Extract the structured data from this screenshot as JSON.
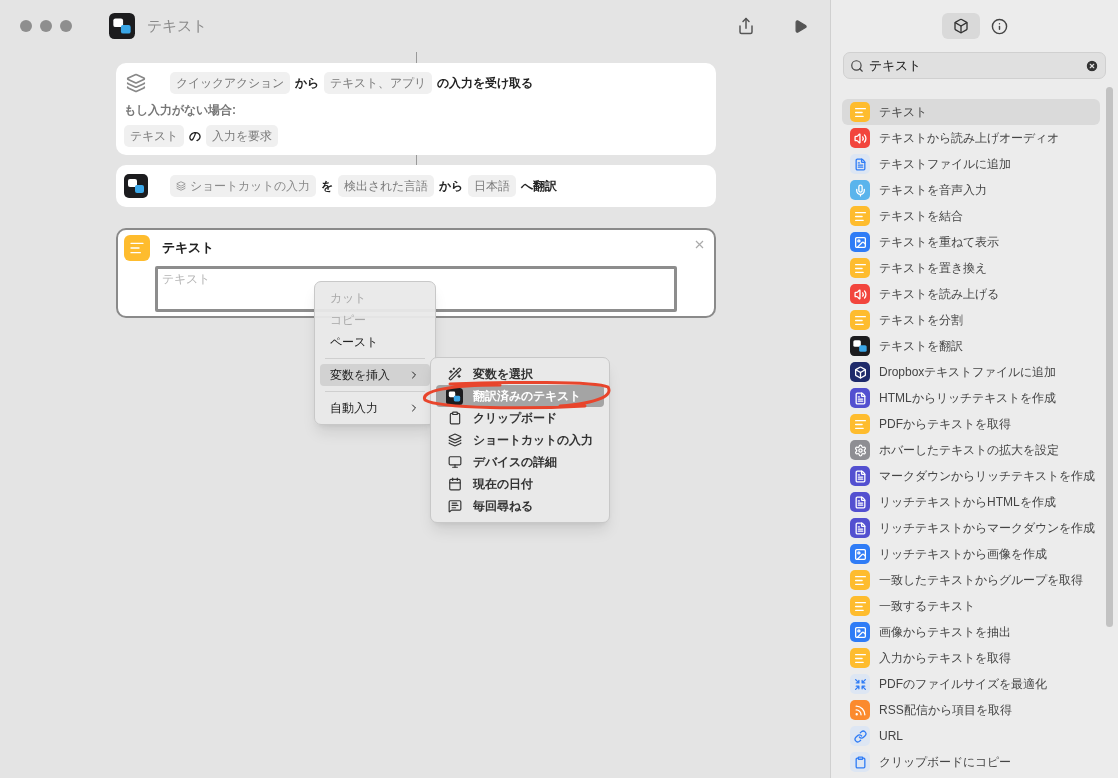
{
  "window": {
    "title": "テキスト"
  },
  "actions": [
    {
      "kind": "receive",
      "lines": [
        [
          {
            "kind": "chip",
            "text": "クイックアクション"
          },
          {
            "kind": "word",
            "text": "から"
          },
          {
            "kind": "chip",
            "text": "テキスト、アプリ"
          },
          {
            "kind": "word",
            "text": "の入力を受け取る"
          }
        ],
        [
          {
            "kind": "label",
            "text": "もし入力がない場合:"
          }
        ],
        [
          {
            "kind": "chip",
            "text": "テキスト"
          },
          {
            "kind": "word",
            "text": "の"
          },
          {
            "kind": "chip",
            "text": "入力を要求"
          }
        ]
      ]
    },
    {
      "kind": "translate",
      "lines": [
        [
          {
            "kind": "variable",
            "text": "ショートカットの入力"
          },
          {
            "kind": "word",
            "text": "を"
          },
          {
            "kind": "chip",
            "text": "検出された言語"
          },
          {
            "kind": "word",
            "text": "から"
          },
          {
            "kind": "chip",
            "text": "日本語"
          },
          {
            "kind": "word",
            "text": "へ翻訳"
          }
        ]
      ]
    },
    {
      "kind": "text",
      "title": "テキスト",
      "placeholder": "テキスト",
      "selected": true
    }
  ],
  "context_menu": {
    "items": [
      {
        "kind": "action",
        "label": "カット",
        "disabled": true,
        "selected": false
      },
      {
        "kind": "action",
        "label": "コピー",
        "disabled": true,
        "selected": false
      },
      {
        "kind": "action",
        "label": "ペースト",
        "disabled": false,
        "selected": false
      },
      {
        "kind": "submenu",
        "label": "変数を挿入",
        "disabled": false,
        "selected": true
      },
      {
        "kind": "submenu",
        "label": "自動入力",
        "disabled": false,
        "selected": false
      }
    ],
    "submenu": [
      {
        "kind": "wand",
        "label": "変数を選択",
        "selected": false
      },
      {
        "kind": "translate",
        "label": "翻訳済みのテキスト",
        "selected": true
      },
      {
        "kind": "clipboard",
        "label": "クリップボード",
        "selected": false
      },
      {
        "kind": "layers",
        "label": "ショートカットの入力",
        "selected": false
      },
      {
        "kind": "monitor",
        "label": "デバイスの詳細",
        "selected": false
      },
      {
        "kind": "calendar",
        "label": "現在の日付",
        "selected": false
      },
      {
        "kind": "speech",
        "label": "毎回尋ねる",
        "selected": false
      }
    ]
  },
  "sidebar": {
    "search": {
      "value": "テキスト"
    },
    "items": [
      {
        "kind": "text",
        "label": "テキスト",
        "color": "#febc2e",
        "selected": true
      },
      {
        "kind": "speaker",
        "label": "テキストから読み上げオーディオ",
        "color": "#f2453d",
        "selected": false
      },
      {
        "kind": "file",
        "label": "テキストファイルに追加",
        "color": "#dde6f3",
        "selected": false
      },
      {
        "kind": "mic",
        "label": "テキストを音声入力",
        "color": "#5ab4ec",
        "selected": false
      },
      {
        "kind": "text",
        "label": "テキストを結合",
        "color": "#febc2e",
        "selected": false
      },
      {
        "kind": "overlay",
        "label": "テキストを重ねて表示",
        "color": "#2f7cf6",
        "selected": false
      },
      {
        "kind": "text",
        "label": "テキストを置き換え",
        "color": "#febc2e",
        "selected": false
      },
      {
        "kind": "speaker",
        "label": "テキストを読み上げる",
        "color": "#f2453d",
        "selected": false
      },
      {
        "kind": "text",
        "label": "テキストを分割",
        "color": "#febc2e",
        "selected": false
      },
      {
        "kind": "translate",
        "label": "テキストを翻訳",
        "color": "#1c1c1e",
        "selected": false
      },
      {
        "kind": "dropbox",
        "label": "Dropboxテキストファイルに追加",
        "color": "#1e2a6b",
        "selected": false
      },
      {
        "kind": "rich",
        "label": "HTMLからリッチテキストを作成",
        "color": "#5350d0",
        "selected": false
      },
      {
        "kind": "text",
        "label": "PDFからテキストを取得",
        "color": "#febc2e",
        "selected": false
      },
      {
        "kind": "gear",
        "label": "ホバーしたテキストの拡大を設定",
        "color": "#8e8e93",
        "selected": false
      },
      {
        "kind": "rich",
        "label": "マークダウンからリッチテキストを作成",
        "color": "#5350d0",
        "selected": false
      },
      {
        "kind": "rich",
        "label": "リッチテキストからHTMLを作成",
        "color": "#5350d0",
        "selected": false
      },
      {
        "kind": "rich",
        "label": "リッチテキストからマークダウンを作成",
        "color": "#5350d0",
        "selected": false
      },
      {
        "kind": "image",
        "label": "リッチテキストから画像を作成",
        "color": "#2f7cf6",
        "selected": false
      },
      {
        "kind": "text",
        "label": "一致したテキストからグループを取得",
        "color": "#febc2e",
        "selected": false
      },
      {
        "kind": "text",
        "label": "一致するテキスト",
        "color": "#febc2e",
        "selected": false
      },
      {
        "kind": "overlay",
        "label": "画像からテキストを抽出",
        "color": "#2f7cf6",
        "selected": false
      },
      {
        "kind": "text",
        "label": "入力からテキストを取得",
        "color": "#febc2e",
        "selected": false
      },
      {
        "kind": "compress",
        "label": "PDFのファイルサイズを最適化",
        "color": "#dde6f3",
        "selected": false
      },
      {
        "kind": "rss",
        "label": "RSS配信から項目を取得",
        "color": "#fb8a2e",
        "selected": false
      },
      {
        "kind": "link",
        "label": "URL",
        "color": "#dde6f3",
        "selected": false
      },
      {
        "kind": "clipboard",
        "label": "クリップボードにコピー",
        "color": "#dde6f3",
        "selected": false
      }
    ]
  }
}
